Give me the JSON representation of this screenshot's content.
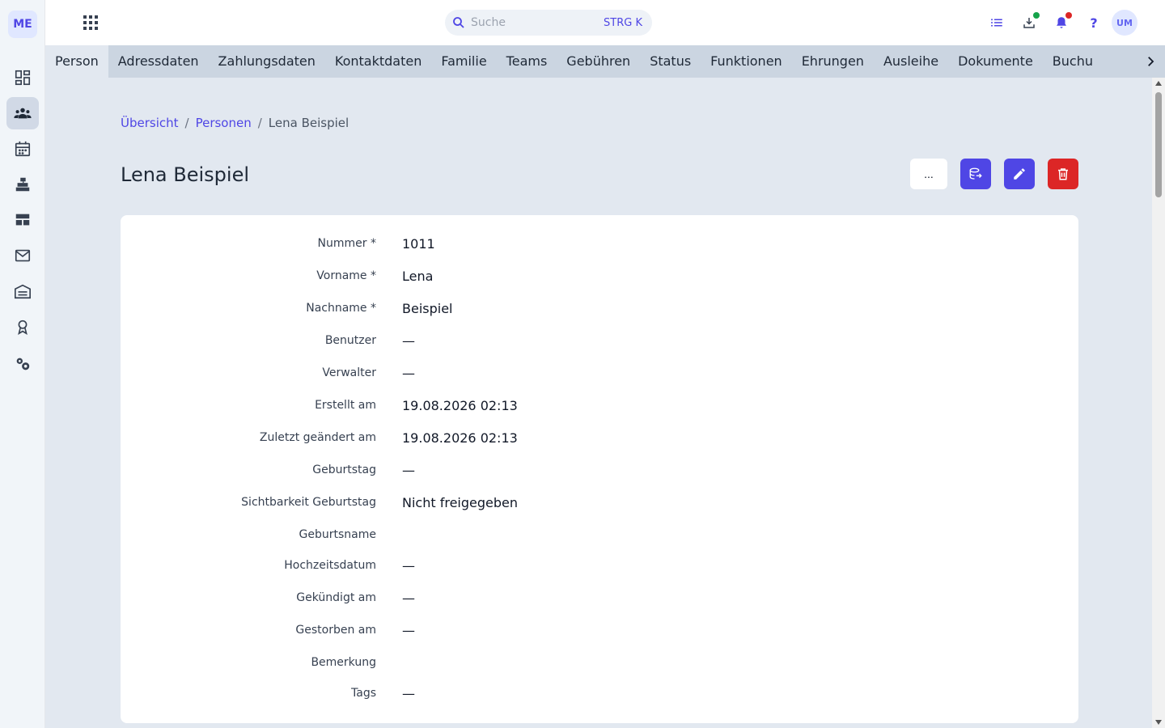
{
  "app": {
    "logo": "ME"
  },
  "rail": {
    "items": [
      {
        "name": "dashboard-icon",
        "active": false
      },
      {
        "name": "people-icon",
        "active": true
      },
      {
        "name": "calendar-icon",
        "active": false
      },
      {
        "name": "cash-register-icon",
        "active": false
      },
      {
        "name": "table-icon",
        "active": false
      },
      {
        "name": "mail-icon",
        "active": false
      },
      {
        "name": "warehouse-icon",
        "active": false
      },
      {
        "name": "award-icon",
        "active": false
      },
      {
        "name": "settings-icon",
        "active": false
      }
    ]
  },
  "search": {
    "placeholder": "Suche",
    "shortcut": "STRG K"
  },
  "user": {
    "initials": "UM"
  },
  "colors": {
    "accent": "#4f46e5",
    "danger": "#dc2626",
    "dot_green": "#16a34a",
    "dot_red": "#dc2626"
  },
  "tabs": [
    "Person",
    "Adressdaten",
    "Zahlungsdaten",
    "Kontaktdaten",
    "Familie",
    "Teams",
    "Gebühren",
    "Status",
    "Funktionen",
    "Ehrungen",
    "Ausleihe",
    "Dokumente",
    "Buchu"
  ],
  "breadcrumb": {
    "overview": "Übersicht",
    "persons": "Personen",
    "current": "Lena Beispiel",
    "sep": "/"
  },
  "page": {
    "title": "Lena Beispiel",
    "more_label": "..."
  },
  "fields": [
    {
      "label": "Nummer *",
      "value": "1011"
    },
    {
      "label": "Vorname *",
      "value": "Lena"
    },
    {
      "label": "Nachname *",
      "value": "Beispiel"
    },
    {
      "label": "Benutzer",
      "value": "—"
    },
    {
      "label": "Verwalter",
      "value": "—"
    },
    {
      "label": "Erstellt am",
      "value": "19.08.2026 02:13"
    },
    {
      "label": "Zuletzt geändert am",
      "value": "19.08.2026 02:13"
    },
    {
      "label": "Geburtstag",
      "value": "—"
    },
    {
      "label": "Sichtbarkeit Geburtstag",
      "value": "Nicht freigegeben"
    },
    {
      "label": "Geburtsname",
      "value": ""
    },
    {
      "label": "Hochzeitsdatum",
      "value": "—"
    },
    {
      "label": "Gekündigt am",
      "value": "—"
    },
    {
      "label": "Gestorben am",
      "value": "—"
    },
    {
      "label": "Bemerkung",
      "value": ""
    },
    {
      "label": "Tags",
      "value": "—"
    }
  ]
}
